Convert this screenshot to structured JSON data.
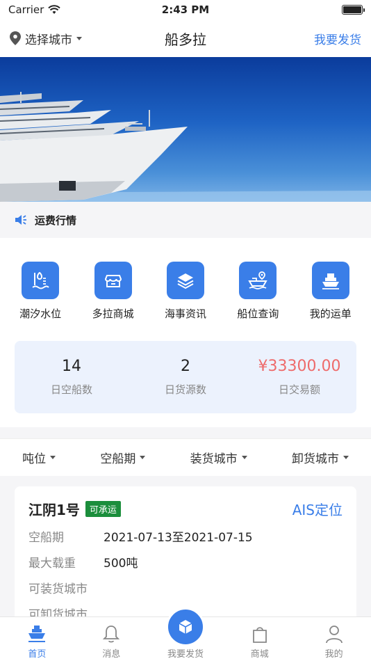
{
  "status_bar": {
    "carrier": "Carrier",
    "time": "2:43 PM"
  },
  "nav": {
    "city": "选择城市",
    "title": "船多拉",
    "post": "我要发货"
  },
  "notice": {
    "label": "运费行情"
  },
  "quick_items": [
    {
      "label": "潮汐水位",
      "icon": "tide-icon"
    },
    {
      "label": "多拉商城",
      "icon": "store-icon"
    },
    {
      "label": "海事资讯",
      "icon": "layers-icon"
    },
    {
      "label": "船位查询",
      "icon": "ship-location-icon"
    },
    {
      "label": "我的运单",
      "icon": "cargo-ship-icon"
    }
  ],
  "stats": [
    {
      "value": "14",
      "label": "日空船数"
    },
    {
      "value": "2",
      "label": "日货源数"
    },
    {
      "value": "¥33300.00",
      "label": "日交易额"
    }
  ],
  "filters": [
    "吨位",
    "空船期",
    "装货城市",
    "卸货城市"
  ],
  "ship": {
    "name": "江阴1号",
    "badge": "可承运",
    "ais": "AIS定位",
    "rows": [
      {
        "k": "空船期",
        "v": "2021-07-13至2021-07-15"
      },
      {
        "k": "最大载重",
        "v": "500吨"
      },
      {
        "k": "可装货城市",
        "v": ""
      },
      {
        "k": "可卸货城市",
        "v": ""
      }
    ]
  },
  "tabs": [
    {
      "label": "首页",
      "icon": "home-ship-icon"
    },
    {
      "label": "消息",
      "icon": "bell-icon"
    },
    {
      "label": "我要发货",
      "icon": "box-icon"
    },
    {
      "label": "商城",
      "icon": "shopping-bag-icon"
    },
    {
      "label": "我的",
      "icon": "user-icon"
    }
  ],
  "colors": {
    "primary": "#3a7ee8",
    "money": "#ee6b6b",
    "badge": "#1b8e3c"
  }
}
